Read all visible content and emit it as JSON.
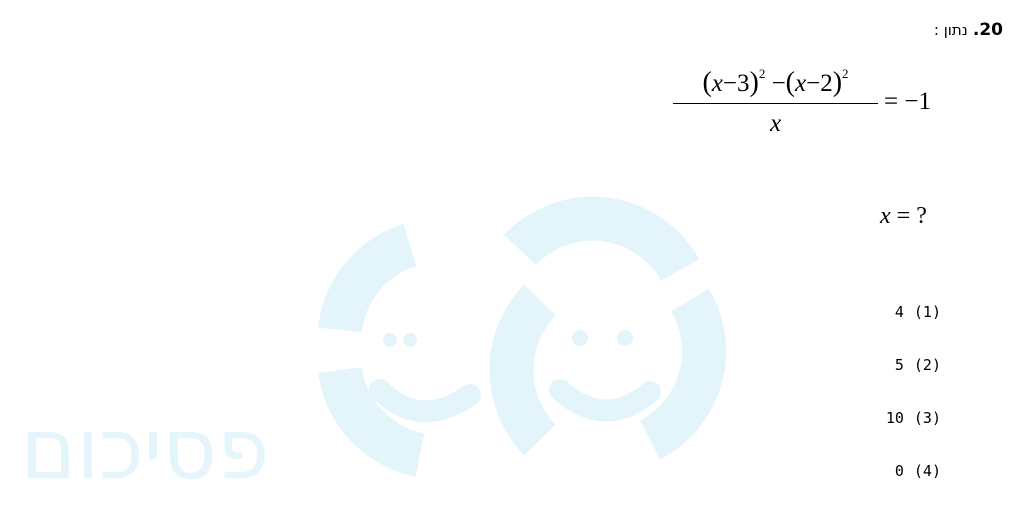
{
  "question": {
    "number": "20.",
    "label": "נתון :",
    "equation": {
      "numerator_part1": "x",
      "numerator_part1_rest": "−3",
      "numerator_exp1": "2",
      "numerator_minus": "−",
      "numerator_part2": "x",
      "numerator_part2_rest": "−2",
      "numerator_exp2": "2",
      "denominator": "x",
      "rhs": "= −1"
    },
    "ask_var": "x",
    "ask_rest": " = ?"
  },
  "answers": [
    {
      "value": "4",
      "index": "(1)"
    },
    {
      "value": "5",
      "index": "(2)"
    },
    {
      "value": "10",
      "index": "(3)"
    },
    {
      "value": "0",
      "index": "(4)"
    }
  ],
  "watermark": {
    "text": "פסיכום",
    "color": "#e4f5fb"
  }
}
